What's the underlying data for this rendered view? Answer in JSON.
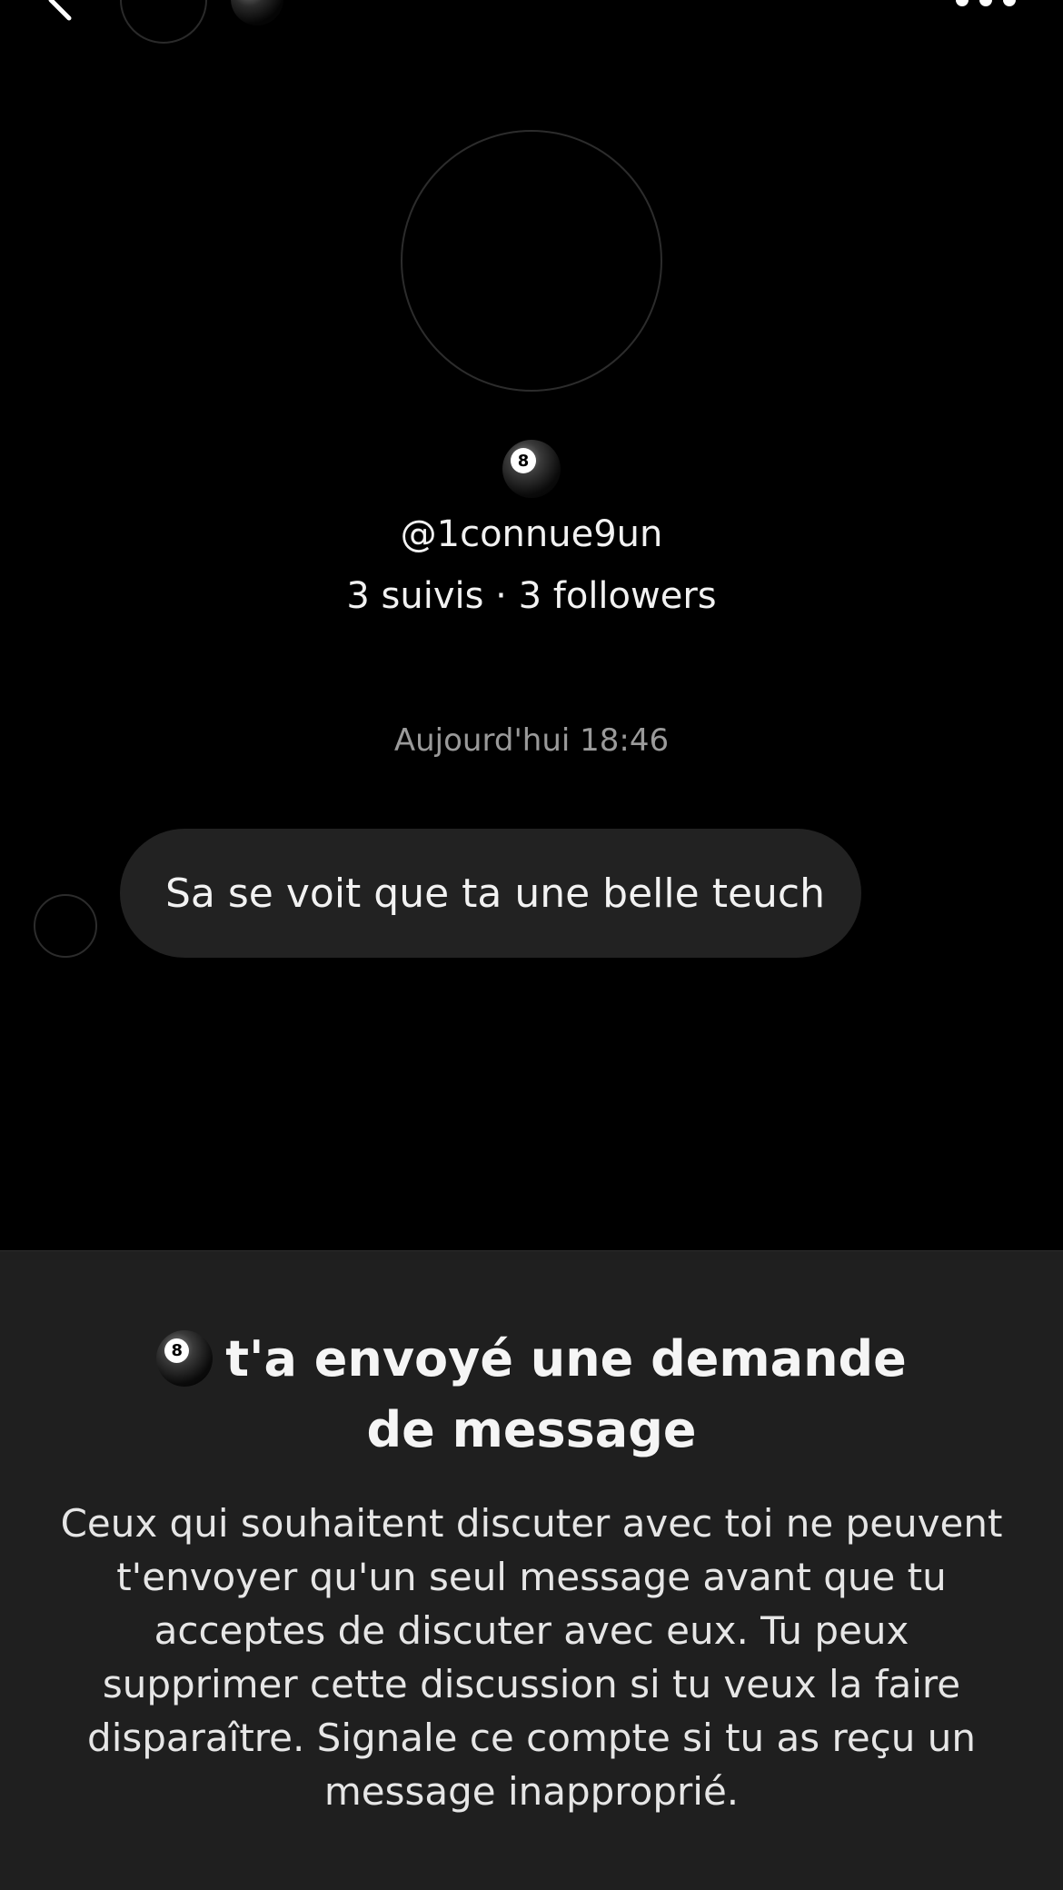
{
  "header": {
    "back_icon": "chevron-left-icon",
    "more_icon": "ellipsis-icon"
  },
  "profile": {
    "emoji": "8-ball",
    "eight_label": "8",
    "username": "@1connue9un",
    "stats": "3 suivis · 3 followers"
  },
  "conversation": {
    "timestamp": "Aujourd'hui 18:46",
    "messages": [
      {
        "text": "Sa se voit que ta une belle teuch",
        "direction": "incoming"
      }
    ]
  },
  "request_panel": {
    "title_line1": "t'a envoyé une demande",
    "title_line2": "de message",
    "body": "Ceux qui souhaitent discuter avec toi ne peuvent t'envoyer qu'un seul message avant que tu acceptes de discuter avec eux. Tu peux supprimer cette discussion si tu veux la faire disparaître. Signale ce compte si tu as reçu un message inapproprié."
  },
  "colors": {
    "background": "#000000",
    "bubble": "#222222",
    "panel": "#1f1f1f",
    "muted_text": "#9a9a9a"
  }
}
